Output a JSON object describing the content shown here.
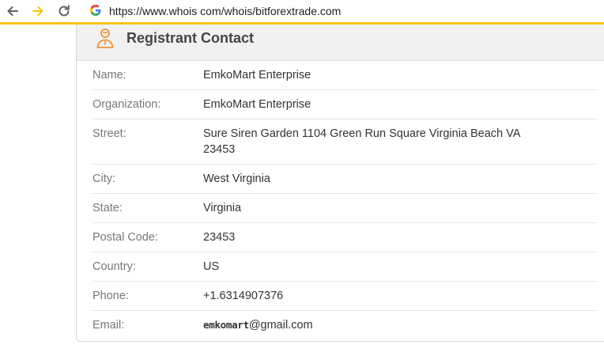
{
  "browser": {
    "url": "https://www.whois com/whois/bitforextrade.com",
    "back_icon": "arrow-left-icon",
    "forward_icon": "arrow-right-icon",
    "reload_icon": "reload-icon"
  },
  "card": {
    "title": "Registrant Contact",
    "icon": "person-icon",
    "accent_color": "#f0923a",
    "rows": [
      {
        "label": "Name:",
        "value": "EmkoMart Enterprise"
      },
      {
        "label": "Organization:",
        "value": "EmkoMart Enterprise"
      },
      {
        "label": "Street:",
        "value": "Sure Siren Garden 1104 Green Run Square Virginia Beach VA 23453"
      },
      {
        "label": "City:",
        "value": "West Virginia"
      },
      {
        "label": "State:",
        "value": "Virginia"
      },
      {
        "label": "Postal Code:",
        "value": "23453"
      },
      {
        "label": "Country:",
        "value": "US"
      },
      {
        "label": "Phone:",
        "value": "+1.6314907376"
      },
      {
        "label": "Email:",
        "value_prefix": "emkomart",
        "value_suffix": "@gmail.com"
      }
    ]
  }
}
